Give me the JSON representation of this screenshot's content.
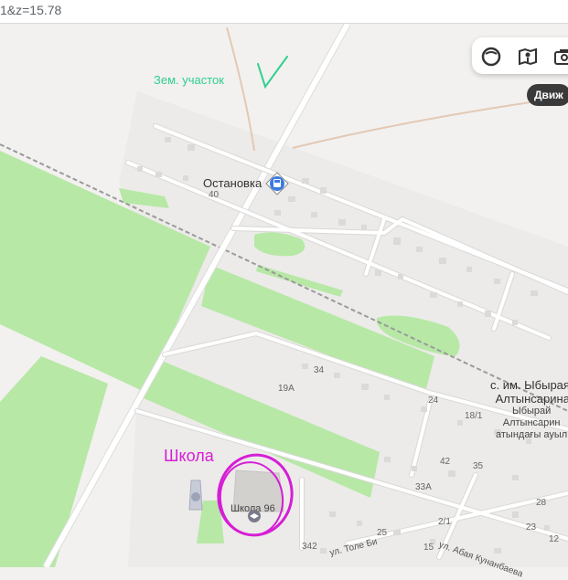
{
  "browser": {
    "url_fragment": "1&z=15.78"
  },
  "map": {
    "stop_label": "Остановка",
    "village_name_line1": "с. им. Ыбырая",
    "village_name_line2": "Алтынсарина",
    "village_kz_line1": "Ыбырай",
    "village_kz_line2": "Алтынсарин",
    "village_kz_line3": "атындағы ауыл",
    "school_label": "Школа 96",
    "street_1": "ул. Толе Би",
    "street_2": "ул. Абая Кунанбаева",
    "house_numbers": [
      "40",
      "34",
      "19А",
      "24",
      "18/1",
      "42",
      "35",
      "33А",
      "28",
      "2/1",
      "25",
      "23",
      "15",
      "342",
      "12"
    ]
  },
  "annotations": {
    "plot_label": "Зем. участок",
    "school_label": "Школа",
    "color_green": "#2ecf8f",
    "color_pink": "#d61ed6"
  },
  "controls": {
    "traffic_label": "Движ",
    "icons": [
      "layers-icon",
      "panorama-icon",
      "camera-icon"
    ]
  },
  "colors": {
    "background": "#f2f1ef",
    "green_area": "#b7e8a6",
    "road": "#ffffff",
    "road_casing": "#dcdcdc",
    "building": "#dcdad7",
    "railway": "#9a9a9a",
    "dirt_track": "#e3c9b5"
  }
}
